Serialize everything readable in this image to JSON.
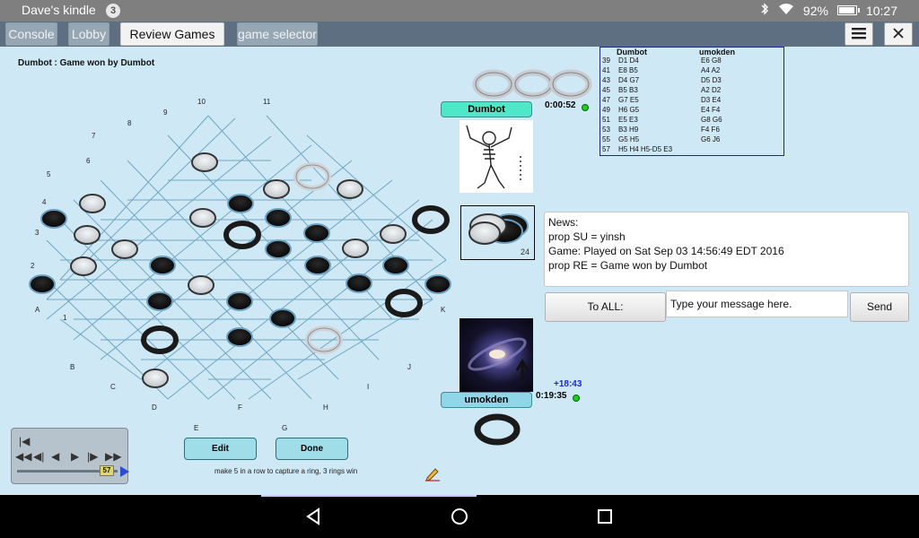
{
  "status_bar": {
    "title": "Dave's kindle",
    "notification_count": "3",
    "battery": "92%",
    "time": "10:27",
    "battery_level": 0.92
  },
  "tabs": [
    {
      "label": "Console",
      "active": false
    },
    {
      "label": "Lobby",
      "active": false
    },
    {
      "label": "Review Games #3",
      "active": true
    },
    {
      "label": "game selector",
      "active": false
    }
  ],
  "toolbar": {
    "menu_icon": "hamburger-icon",
    "close_icon": "close-icon"
  },
  "game": {
    "status": "Dumbot : Game won by Dumbot",
    "row_labels": [
      "10",
      "11",
      "9",
      "8",
      "7",
      "6",
      "5",
      "4",
      "3",
      "2",
      "1"
    ],
    "col_labels": [
      "A",
      "B",
      "C",
      "D",
      "E",
      "F",
      "G",
      "H",
      "I",
      "J",
      "K"
    ],
    "captured_count": "24",
    "hint": "make 5 in a row to capture a ring, 3 rings win",
    "edit_label": "Edit",
    "done_label": "Done",
    "move_index": "57"
  },
  "players": {
    "p1": {
      "name": "Dumbot",
      "clock": "0:00:52"
    },
    "p2": {
      "name": "umokden",
      "clock": "0:19:35",
      "time_delta": "+18:43"
    }
  },
  "moves": {
    "col1_header": "Dumbot",
    "col2_header": "umokden",
    "rows": [
      {
        "n": "39",
        "a": "D1 D4",
        "b": "E6 G8"
      },
      {
        "n": "41",
        "a": "E8 B5",
        "b": "A4 A2"
      },
      {
        "n": "43",
        "a": "D4 G7",
        "b": "D5 D3"
      },
      {
        "n": "45",
        "a": "B5 B3",
        "b": "A2 D2"
      },
      {
        "n": "47",
        "a": "G7 E5",
        "b": "D3 E4"
      },
      {
        "n": "49",
        "a": "H6 G5",
        "b": "E4 F4"
      },
      {
        "n": "51",
        "a": "E5 E3",
        "b": "G8 G6"
      },
      {
        "n": "53",
        "a": "B3 H9",
        "b": "F4 F6"
      },
      {
        "n": "55",
        "a": "G5 H5",
        "b": "G6 J6"
      },
      {
        "n": "57",
        "a": "H5 H4 H5-D5 E3",
        "b": ""
      }
    ]
  },
  "news": {
    "lines": [
      "News:",
      "prop SU = yinsh",
      "Game: Played on Sat Sep 03 14:56:49 EDT 2016",
      "prop RE = Game won by Dumbot"
    ]
  },
  "chat": {
    "to_all_label": "To ALL:",
    "placeholder": "Type your message here.",
    "send_label": "Send"
  },
  "colors": {
    "accent_p1": "#4ee8c8",
    "accent_p2": "#8fd7e8",
    "board_line": "#6fa7c4"
  }
}
